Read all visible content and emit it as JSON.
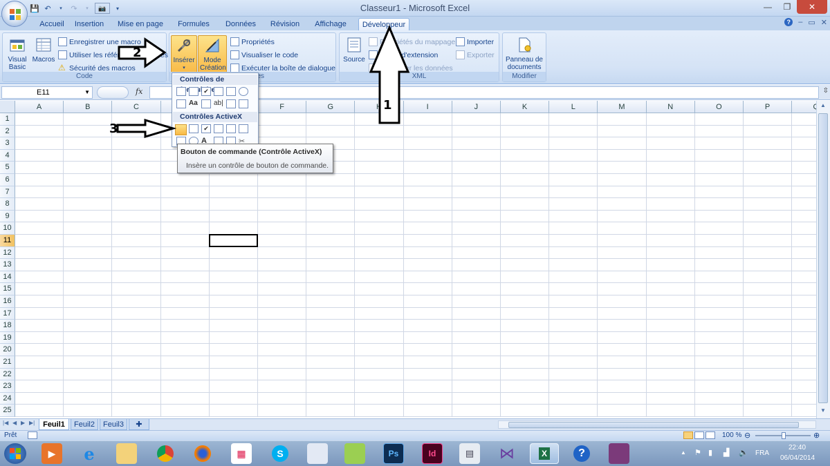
{
  "window": {
    "title": "Classeur1 - Microsoft Excel"
  },
  "tabs": [
    "Accueil",
    "Insertion",
    "Mise en page",
    "Formules",
    "Données",
    "Révision",
    "Affichage",
    "Développeur"
  ],
  "active_tab": "Développeur",
  "ribbon": {
    "code": {
      "label": "Code",
      "visual_basic": "Visual Basic",
      "macros": "Macros",
      "record_macro": "Enregistrer une macro",
      "relative_refs": "Utiliser les références relatives",
      "macro_security": "Sécurité des macros"
    },
    "controls": {
      "insert": "Insérer",
      "design_mode": "Mode Création",
      "properties": "Propriétés",
      "view_code": "Visualiser le code",
      "run_dialog": "Exécuter la boîte de dialogue",
      "label_partial": "lles"
    },
    "xml": {
      "label": "XML",
      "source": "Source",
      "map_props": "Propriétés du mappage",
      "ext_packs": "Packs d'extension",
      "refresh_data": "Actualiser les données",
      "import": "Importer",
      "export": "Exporter"
    },
    "modify": {
      "label": "Modifier",
      "doc_panel": "Panneau de documents"
    }
  },
  "formula_bar": {
    "name_box": "E11",
    "fx": "fx",
    "value": ""
  },
  "grid": {
    "columns": [
      "A",
      "B",
      "C",
      "D",
      "E",
      "F",
      "G",
      "H",
      "I",
      "J",
      "K",
      "L",
      "M",
      "N",
      "O",
      "P",
      "Q"
    ],
    "rows": [
      "1",
      "2",
      "3",
      "4",
      "5",
      "6",
      "7",
      "8",
      "9",
      "10",
      "11",
      "12",
      "13",
      "14",
      "15",
      "16",
      "17",
      "18",
      "19",
      "20",
      "21",
      "22",
      "23",
      "24",
      "25"
    ],
    "selected_cell": "E11"
  },
  "sheets": [
    "Feuil1",
    "Feuil2",
    "Feuil3"
  ],
  "active_sheet": "Feuil1",
  "status": {
    "ready": "Prêt",
    "zoom": "100 %"
  },
  "dropdown": {
    "form_controls": "Contrôles de formulaire",
    "activex_controls": "Contrôles ActiveX"
  },
  "tooltip": {
    "title": "Bouton de commande (Contrôle ActiveX)",
    "body": "Insère un contrôle de bouton de commande."
  },
  "annotations": {
    "a1": "1",
    "a2": "2",
    "a3": "3"
  },
  "taskbar": {
    "lang": "FRA",
    "time": "22:40",
    "date": "06/04/2014"
  },
  "colors": {
    "accent": "#15428b",
    "ribbon_bg": "#d5e3f6",
    "hot": "#f8b844"
  }
}
